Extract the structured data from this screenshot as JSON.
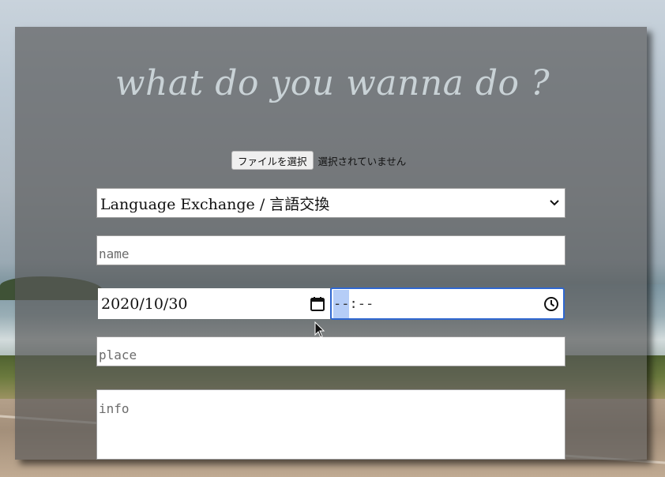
{
  "form": {
    "title": "what do you wanna do ?",
    "file_input": {
      "button_label": "ファイルを選択",
      "status": "選択されていません"
    },
    "category_select": {
      "selected": "Language Exchange / 言語交換",
      "icon": "chevron-down-icon"
    },
    "name_field": {
      "placeholder": "name"
    },
    "date_field": {
      "value": "2020/10/30",
      "icon": "calendar-icon"
    },
    "time_field": {
      "hours": "--",
      "rest": ":--",
      "icon": "clock-icon"
    },
    "place_field": {
      "placeholder": "place"
    },
    "info_field": {
      "placeholder": "info"
    }
  },
  "colors": {
    "panel": "#585858",
    "title": "#c9d2d6",
    "focus": "#2f67d0",
    "selection": "#b5cdf7"
  }
}
